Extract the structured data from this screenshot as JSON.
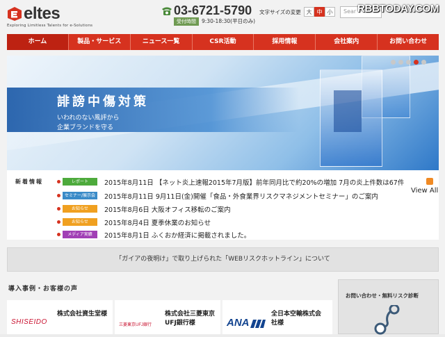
{
  "header": {
    "logo_text": "eltes",
    "logo_tagline": "Exploring Limitless Talents for e-Solutions",
    "phone": "03-6721-5790",
    "hours_label": "受付時間",
    "hours": "9:30-18:30(平日のみ)",
    "font_size_label": "文字サイズの変更",
    "font_sizes": [
      "大",
      "中",
      "小"
    ],
    "search_placeholder": "Sear",
    "watermark": "RBBTODAY.COM"
  },
  "nav": {
    "items": [
      "ホーム",
      "製品・サービス",
      "ニュース一覧",
      "CSR活動",
      "採用情報",
      "会社案内",
      "お問い合わせ"
    ]
  },
  "hero": {
    "title": "誹謗中傷対策",
    "subtitle_line1": "いわれのない風評から",
    "subtitle_line2": "企業ブランドを守る"
  },
  "news": {
    "heading": "新着情報",
    "view_all": "View All",
    "items": [
      {
        "badge": "レポート",
        "badge_color": "#4daa3c",
        "text": "2015年8月11日 【ネット炎上速報2015年7月版】前年同月比で約20%の増加 7月の炎上件数は67件"
      },
      {
        "badge": "セミナー/展示会",
        "badge_color": "#3a8bc8",
        "text": "2015年8月11日 9月11日(金)開催「食品・外食業界リスクマネジメントセミナー」のご案内"
      },
      {
        "badge": "お知らせ",
        "badge_color": "#f0a020",
        "text": "2015年8月6日 大阪オフィス移転のご案内"
      },
      {
        "badge": "お知らせ",
        "badge_color": "#f0a020",
        "text": "2015年8月4日 夏季休業のお知らせ"
      },
      {
        "badge": "メディア実績",
        "badge_color": "#a13fb5",
        "text": "2015年8月1日 ふくおか経済に掲載されました。"
      }
    ]
  },
  "banner": {
    "text": "「ガイアの夜明け」で取り上げられた「WEBリスクホットライン」について"
  },
  "cases": {
    "title": "導入事例・お客様の声",
    "items": [
      {
        "logo": "SHISEIDO",
        "name_line1": "株式会社資生堂様",
        "name_line2": ""
      },
      {
        "logo": "三菱東京UFJ銀行",
        "name_line1": "株式会社三菱東京",
        "name_line2": "UFJ銀行様"
      },
      {
        "logo": "ANA",
        "name_line1": "全日本空輸株式会",
        "name_line2": "社様"
      }
    ]
  },
  "side": {
    "title": "お問い合わせ・無料リスク診断"
  }
}
